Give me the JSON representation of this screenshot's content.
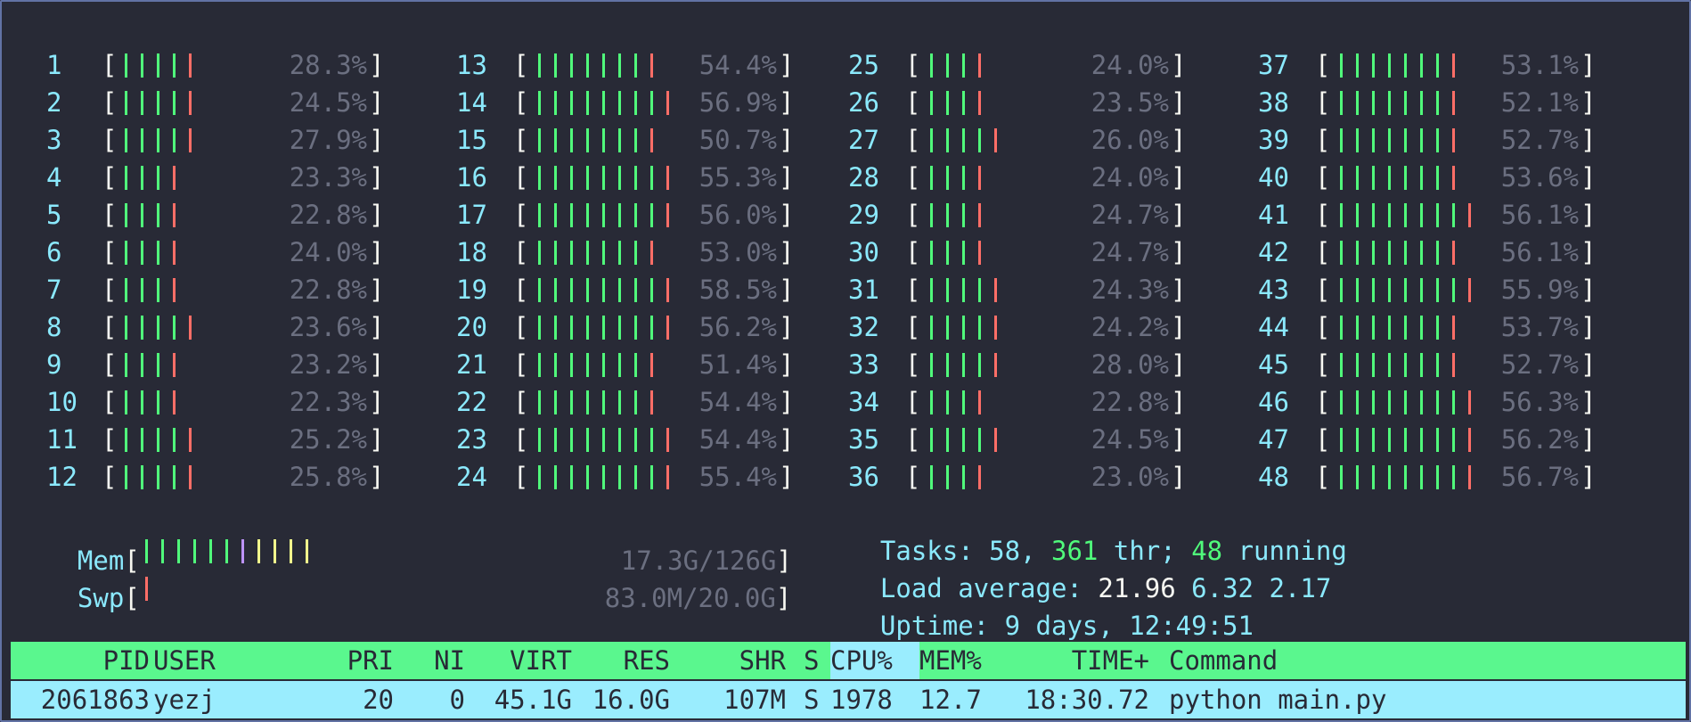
{
  "cpus": [
    {
      "num": "1",
      "pct": "28.3%",
      "green": 4,
      "red": 1
    },
    {
      "num": "2",
      "pct": "24.5%",
      "green": 4,
      "red": 1
    },
    {
      "num": "3",
      "pct": "27.9%",
      "green": 4,
      "red": 1
    },
    {
      "num": "4",
      "pct": "23.3%",
      "green": 3,
      "red": 1
    },
    {
      "num": "5",
      "pct": "22.8%",
      "green": 3,
      "red": 1
    },
    {
      "num": "6",
      "pct": "24.0%",
      "green": 3,
      "red": 1
    },
    {
      "num": "7",
      "pct": "22.8%",
      "green": 3,
      "red": 1
    },
    {
      "num": "8",
      "pct": "23.6%",
      "green": 4,
      "red": 1
    },
    {
      "num": "9",
      "pct": "23.2%",
      "green": 3,
      "red": 1
    },
    {
      "num": "10",
      "pct": "22.3%",
      "green": 3,
      "red": 1
    },
    {
      "num": "11",
      "pct": "25.2%",
      "green": 4,
      "red": 1
    },
    {
      "num": "12",
      "pct": "25.8%",
      "green": 4,
      "red": 1
    },
    {
      "num": "13",
      "pct": "54.4%",
      "green": 7,
      "red": 1
    },
    {
      "num": "14",
      "pct": "56.9%",
      "green": 8,
      "red": 1
    },
    {
      "num": "15",
      "pct": "50.7%",
      "green": 7,
      "red": 1
    },
    {
      "num": "16",
      "pct": "55.3%",
      "green": 8,
      "red": 1
    },
    {
      "num": "17",
      "pct": "56.0%",
      "green": 8,
      "red": 1
    },
    {
      "num": "18",
      "pct": "53.0%",
      "green": 7,
      "red": 1
    },
    {
      "num": "19",
      "pct": "58.5%",
      "green": 8,
      "red": 1
    },
    {
      "num": "20",
      "pct": "56.2%",
      "green": 8,
      "red": 1
    },
    {
      "num": "21",
      "pct": "51.4%",
      "green": 7,
      "red": 1
    },
    {
      "num": "22",
      "pct": "54.4%",
      "green": 7,
      "red": 1
    },
    {
      "num": "23",
      "pct": "54.4%",
      "green": 8,
      "red": 1
    },
    {
      "num": "24",
      "pct": "55.4%",
      "green": 8,
      "red": 1
    },
    {
      "num": "25",
      "pct": "24.0%",
      "green": 3,
      "red": 1
    },
    {
      "num": "26",
      "pct": "23.5%",
      "green": 3,
      "red": 1
    },
    {
      "num": "27",
      "pct": "26.0%",
      "green": 4,
      "red": 1
    },
    {
      "num": "28",
      "pct": "24.0%",
      "green": 3,
      "red": 1
    },
    {
      "num": "29",
      "pct": "24.7%",
      "green": 3,
      "red": 1
    },
    {
      "num": "30",
      "pct": "24.7%",
      "green": 3,
      "red": 1
    },
    {
      "num": "31",
      "pct": "24.3%",
      "green": 4,
      "red": 1
    },
    {
      "num": "32",
      "pct": "24.2%",
      "green": 4,
      "red": 1
    },
    {
      "num": "33",
      "pct": "28.0%",
      "green": 4,
      "red": 1
    },
    {
      "num": "34",
      "pct": "22.8%",
      "green": 3,
      "red": 1
    },
    {
      "num": "35",
      "pct": "24.5%",
      "green": 4,
      "red": 1
    },
    {
      "num": "36",
      "pct": "23.0%",
      "green": 3,
      "red": 1
    },
    {
      "num": "37",
      "pct": "53.1%",
      "green": 7,
      "red": 1
    },
    {
      "num": "38",
      "pct": "52.1%",
      "green": 7,
      "red": 1
    },
    {
      "num": "39",
      "pct": "52.7%",
      "green": 7,
      "red": 1
    },
    {
      "num": "40",
      "pct": "53.6%",
      "green": 7,
      "red": 1
    },
    {
      "num": "41",
      "pct": "56.1%",
      "green": 8,
      "red": 1
    },
    {
      "num": "42",
      "pct": "56.1%",
      "green": 7,
      "red": 1
    },
    {
      "num": "43",
      "pct": "55.9%",
      "green": 8,
      "red": 1
    },
    {
      "num": "44",
      "pct": "53.7%",
      "green": 7,
      "red": 1
    },
    {
      "num": "45",
      "pct": "52.7%",
      "green": 7,
      "red": 1
    },
    {
      "num": "46",
      "pct": "56.3%",
      "green": 8,
      "red": 1
    },
    {
      "num": "47",
      "pct": "56.2%",
      "green": 8,
      "red": 1
    },
    {
      "num": "48",
      "pct": "56.7%",
      "green": 8,
      "red": 1
    }
  ],
  "mem": {
    "label": "Mem",
    "value": "17.3G/126G",
    "segments": [
      "green",
      "green",
      "green",
      "green",
      "green",
      "green",
      "purple",
      "yellow",
      "yellow",
      "yellow",
      "yellow"
    ]
  },
  "swp": {
    "label": "Swp",
    "value": "83.0M/20.0G",
    "segments": [
      "red"
    ]
  },
  "tasks": {
    "label": "Tasks:",
    "count": "58,",
    "threads": "361",
    "thr_label": "thr;",
    "running": "48",
    "running_label": "running"
  },
  "load": {
    "label": "Load average:",
    "one": "21.96",
    "five": "6.32",
    "fifteen": "2.17"
  },
  "uptime": {
    "label": "Uptime:",
    "value": "9 days, 12:49:51"
  },
  "header": {
    "pid": "PID",
    "user": "USER",
    "pri": "PRI",
    "ni": "NI",
    "virt": "VIRT",
    "res": "RES",
    "shr": "SHR",
    "s": "S",
    "cpu": "CPU%",
    "mem": "MEM%",
    "time": "TIME+",
    "command": "Command"
  },
  "processes": [
    {
      "pid": "2061863",
      "user": "yezj",
      "pri": "20",
      "ni": "0",
      "virt": "45.1G",
      "res": "16.0G",
      "shr": "107M",
      "s": "S",
      "cpu": "1978",
      "mem": "12.7",
      "time": "18:30.72",
      "command": "python main.py"
    }
  ],
  "colors": {
    "green": "#50fa7b",
    "red": "#ff6e67",
    "purple": "#bd93f9",
    "yellow": "#f1fa8c",
    "cyan": "#8be9fd",
    "header_bg": "#5af78e",
    "selected_bg": "#9aedfe"
  }
}
